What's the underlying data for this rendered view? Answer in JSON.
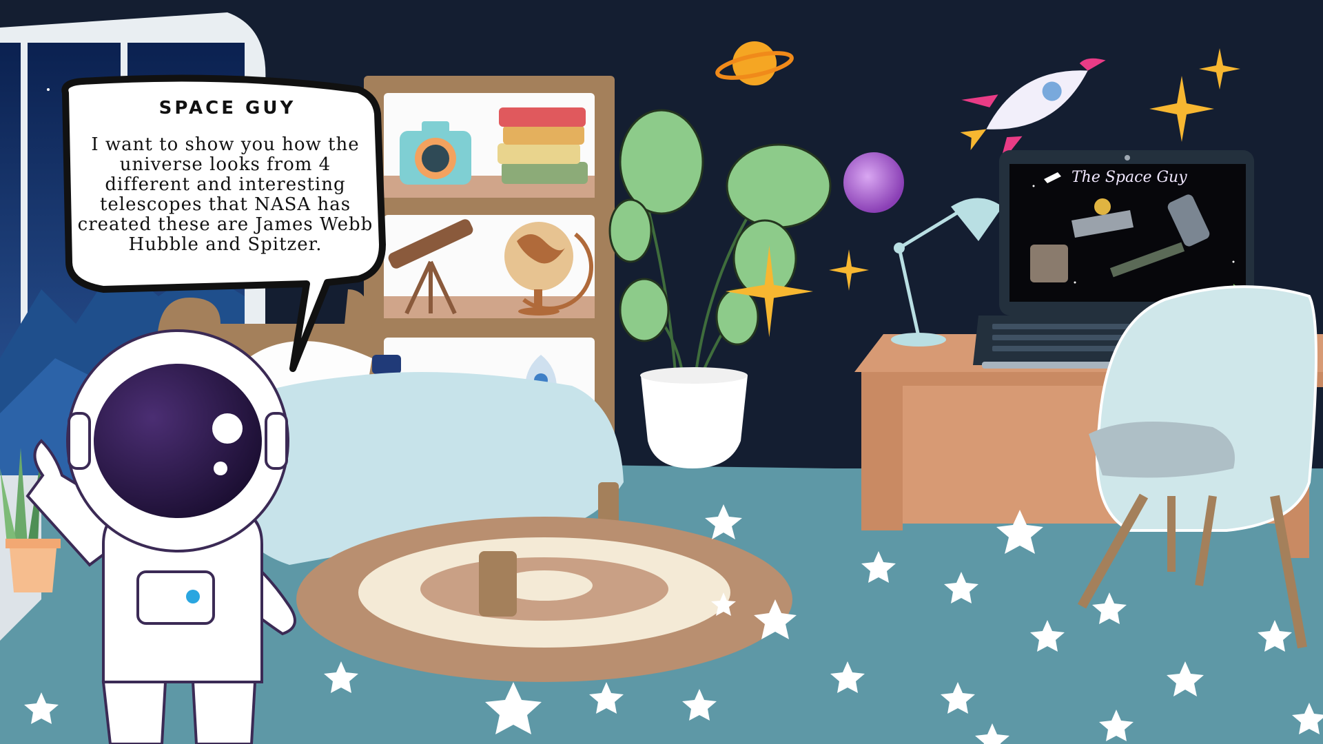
{
  "scene": {
    "name": "Space Guy bedroom scene",
    "colors": {
      "wall": "#141e31",
      "floor": "#5e98a6",
      "rug_outer": "#b98f70",
      "rug_inner": "#f4ead6",
      "desk": "#d79a74",
      "bedsheet": "#c7e3ea",
      "chair": "#cfe7ea"
    }
  },
  "speech_bubble": {
    "title": "SPACE GUY",
    "text": "I want to show you how the universe looks from 4 different and interesting telescopes that NASA has created these are James Webb Hubble and Spitzer."
  },
  "laptop": {
    "screen_title": "The Space Guy"
  }
}
